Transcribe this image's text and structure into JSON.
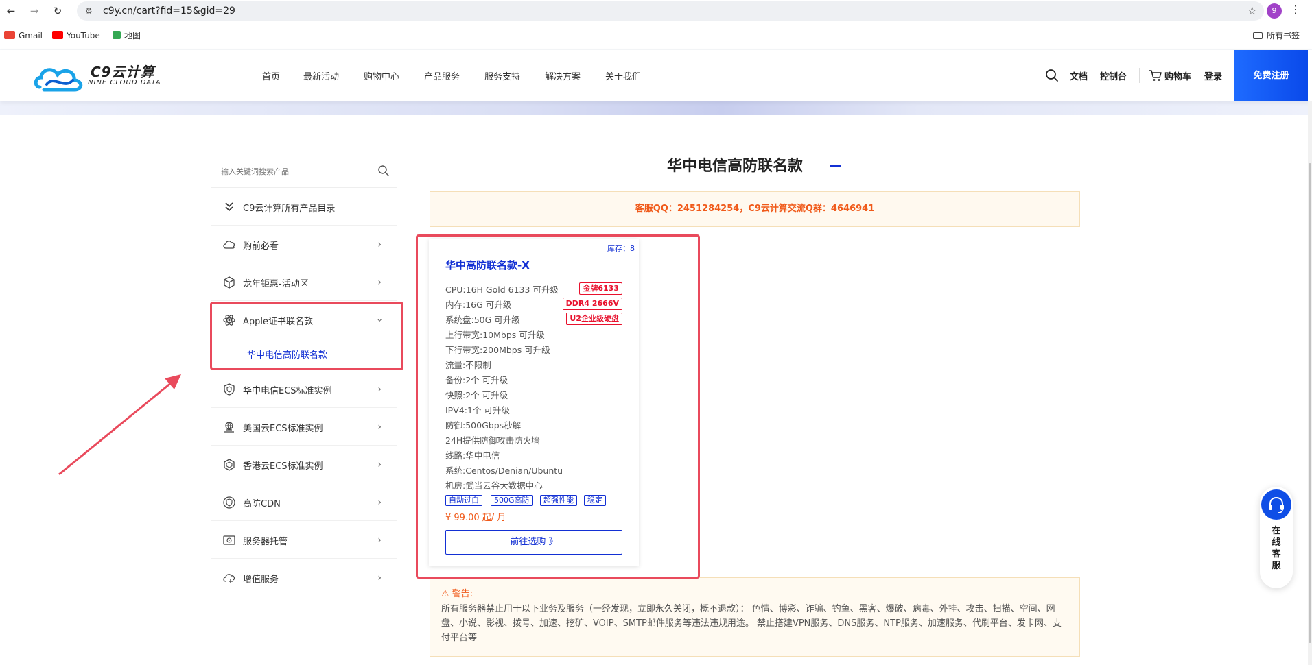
{
  "browser": {
    "url": "c9y.cn/cart?fid=15&gid=29",
    "profile_initial": "9",
    "bookmarks": [
      {
        "label": "Gmail",
        "color": "#ea4335"
      },
      {
        "label": "YouTube",
        "color": "#ff0000"
      },
      {
        "label": "地图",
        "color": "#34a853"
      }
    ],
    "all_bookmarks_label": "所有书签"
  },
  "header": {
    "logo_cn": "C9云计算",
    "logo_en": "NINE CLOUD DATA",
    "nav": [
      "首页",
      "最新活动",
      "购物中心",
      "产品服务",
      "服务支持",
      "解决方案",
      "关于我们"
    ],
    "docs": "文档",
    "console": "控制台",
    "cart": "购物车",
    "login": "登录",
    "register": "免费注册"
  },
  "sidebar": {
    "search_placeholder": "输入关键词搜索产品",
    "catalog": "C9云计算所有产品目录",
    "items": [
      {
        "label": "购前必看",
        "icon": "cloud-icon"
      },
      {
        "label": "龙年钜惠-活动区",
        "icon": "cube-icon"
      },
      {
        "label": "Apple证书联名款",
        "icon": "atom-icon"
      },
      {
        "label": "华中电信ECS标准实例",
        "icon": "shield-icon"
      },
      {
        "label": "美国云ECS标准实例",
        "icon": "globe-server-icon"
      },
      {
        "label": "香港云ECS标准实例",
        "icon": "hexagon-icon"
      },
      {
        "label": "高防CDN",
        "icon": "cdn-shield-icon"
      },
      {
        "label": "服务器托管",
        "icon": "server-icon"
      },
      {
        "label": "增值服务",
        "icon": "cloud-plus-icon"
      }
    ],
    "sub_item": "华中电信高防联名款"
  },
  "content": {
    "title": "华中电信高防联名款",
    "notice": "客服QQ：2451284254，C9云计算交流Q群：4646941",
    "product": {
      "stock": "库存：8",
      "name": "华中高防联名款-X",
      "specs": [
        "CPU:16H Gold 6133 可升级",
        "内存:16G 可升级",
        "系统盘:50G 可升级",
        "上行带宽:10Mbps 可升级",
        "下行带宽:200Mbps 可升级",
        "流量:不限制",
        "备份:2个 可升级",
        "快照:2个 可升级",
        "IPV4:1个 可升级",
        "防御:500Gbps秒解",
        "24H提供防御攻击防火墙",
        "线路:华中电信",
        "系统:Centos/Denian/Ubuntu",
        "机房:武当云谷大数据中心"
      ],
      "badges": [
        "金牌6133",
        "DDR4 2666V",
        "U2企业级硬盘"
      ],
      "tags": [
        "自动过白",
        "500G高防",
        "超强性能",
        "稳定"
      ],
      "price": "¥ 99.00 起/ 月",
      "button": "前往选购 》"
    },
    "warning_title": "⚠ 警告:",
    "warning_text": "所有服务器禁止用于以下业务及服务（一经发现，立即永久关闭，概不退款）： 色情、博彩、诈骗、钓鱼、黑客、爆破、病毒、外挂、攻击、扫描、空间、网盘、小说、影视、拨号、加速、挖矿、VOIP、SMTP邮件服务等违法违规用途。 禁止搭建VPN服务、DNS服务、NTP服务、加速服务、代刷平台、发卡网、支付平台等"
  },
  "service_widget": {
    "label": "在线客服"
  }
}
